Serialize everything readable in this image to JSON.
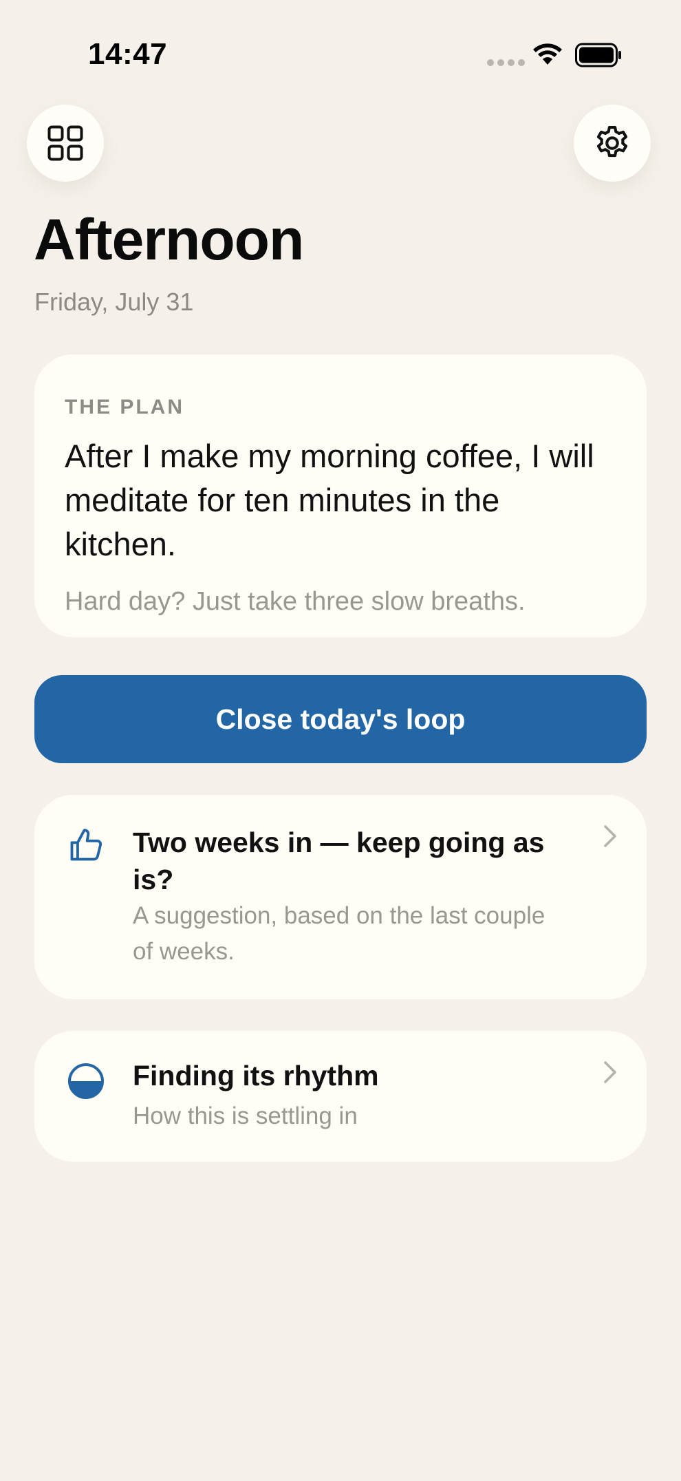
{
  "status_bar": {
    "time": "14:47"
  },
  "toolbar": {
    "grid_icon": "grid-icon",
    "settings_icon": "gear-icon"
  },
  "header": {
    "title": "Afternoon",
    "date": "Friday, July 31"
  },
  "plan": {
    "label": "THE PLAN",
    "text": "After I make my morning coffee, I will meditate for ten minutes in the kitchen.",
    "fallback": "Hard day? Just take three slow breaths."
  },
  "primary_action": {
    "label": "Close today's loop"
  },
  "cards": [
    {
      "icon": "thumbs-up-icon",
      "title": "Two weeks in — keep going as is?",
      "subtitle": "A suggestion, based on the last couple of weeks."
    },
    {
      "icon": "half-circle-icon",
      "title": "Finding its rhythm",
      "subtitle": "How this is settling in"
    }
  ],
  "colors": {
    "background": "#f5f1ea",
    "card": "#fffdf6",
    "accent": "#2366a5",
    "muted_text": "#9a9691"
  }
}
